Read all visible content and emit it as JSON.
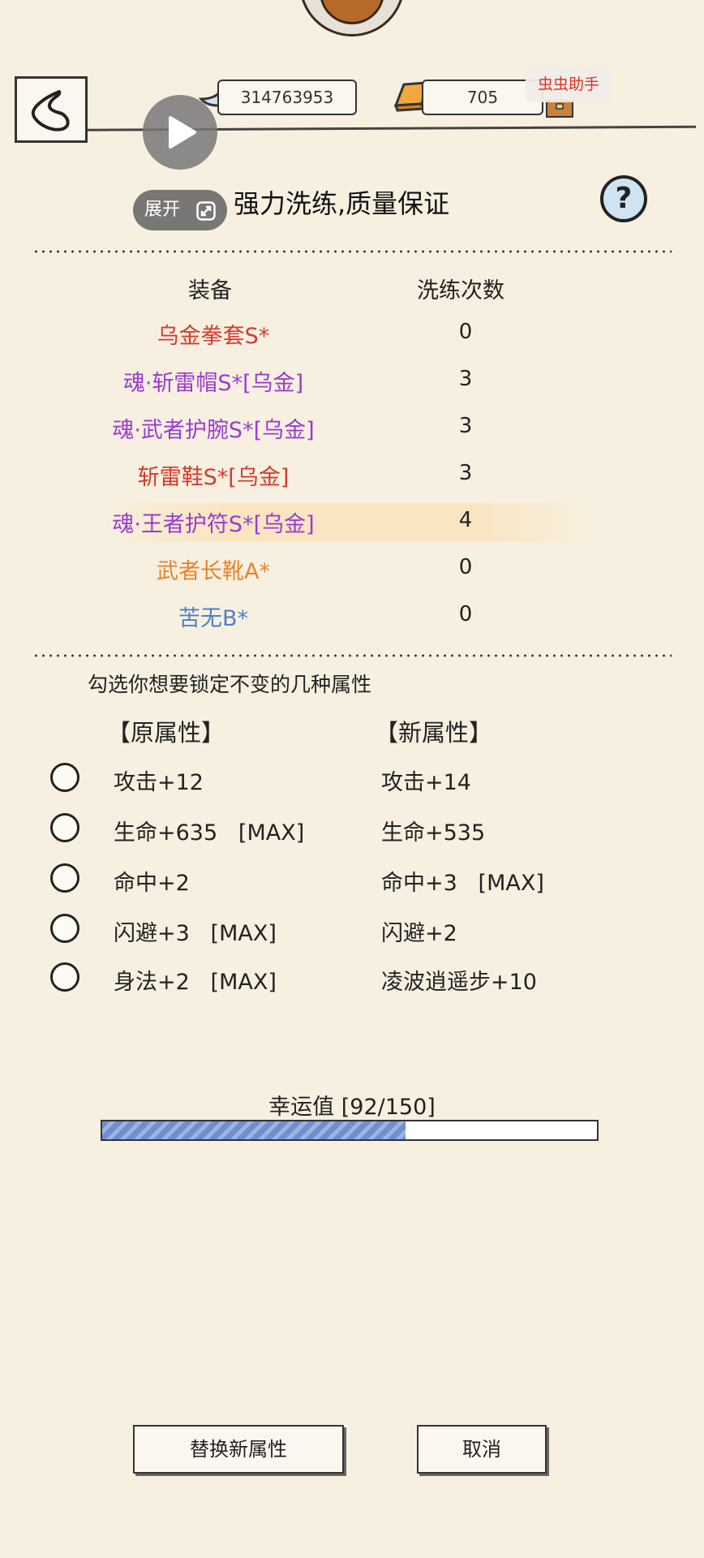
{
  "header": {
    "silver_amount": "314763953",
    "gold_amount": "705",
    "helper_label": "虫虫助手",
    "expand_label": "展开",
    "title": "强力洗练,质量保证",
    "help_symbol": "?"
  },
  "table": {
    "col_equipment": "装备",
    "col_wash_count": "洗练次数",
    "rows": [
      {
        "name": "乌金拳套S*",
        "count": "0",
        "color": "#d63a2c"
      },
      {
        "name": "魂·斩雷帽S*[乌金]",
        "count": "3",
        "color": "#9a3ccf"
      },
      {
        "name": "魂·武者护腕S*[乌金]",
        "count": "3",
        "color": "#9a3ccf"
      },
      {
        "name": "斩雷鞋S*[乌金]",
        "count": "3",
        "color": "#d63a2c"
      },
      {
        "name": "魂·王者护符S*[乌金]",
        "count": "4",
        "color": "#9a3ccf"
      },
      {
        "name": "武者长靴A*",
        "count": "0",
        "color": "#e8832a"
      },
      {
        "name": "苦无B*",
        "count": "0",
        "color": "#4f7fc0"
      }
    ]
  },
  "attributes": {
    "lock_hint": "勾选你想要锁定不变的几种属性",
    "old_header": "【原属性】",
    "new_header": "【新属性】",
    "rows": [
      {
        "old": "攻击+12",
        "new": "攻击+14"
      },
      {
        "old": "生命+635   [MAX]",
        "new": "生命+535"
      },
      {
        "old": "命中+2",
        "new": "命中+3   [MAX]"
      },
      {
        "old": "闪避+3   [MAX]",
        "new": "闪避+2"
      },
      {
        "old": "身法+2   [MAX]",
        "new": "凌波逍遥步+10"
      }
    ]
  },
  "luck": {
    "label": "幸运值 [92/150]",
    "value": 92,
    "max": 150
  },
  "buttons": {
    "replace": "替换新属性",
    "cancel": "取消"
  },
  "icons": [
    "back-arrow-icon",
    "play-icon",
    "silver-ingot-icon",
    "gold-bar-icon",
    "chest-icon",
    "expand-icon",
    "help-icon"
  ]
}
